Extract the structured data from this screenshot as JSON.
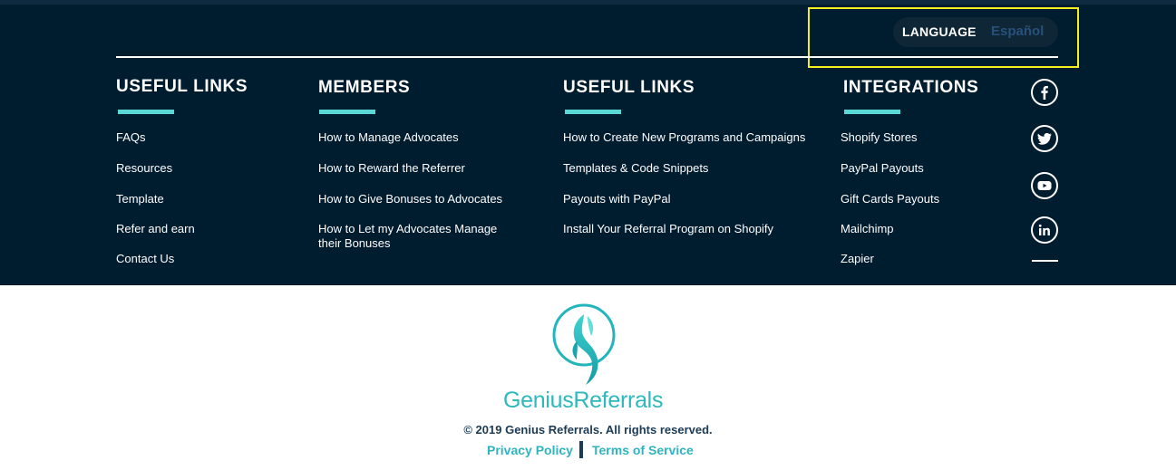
{
  "language": {
    "label": "LANGUAGE",
    "value": "Español"
  },
  "columns": [
    {
      "title": "USEFUL LINKS",
      "links": [
        "FAQs",
        "Resources",
        "Template",
        "Refer and earn",
        "Contact Us"
      ]
    },
    {
      "title": "MEMBERS",
      "links": [
        "How to Manage Advocates",
        "How to Reward the Referrer",
        "How to Give Bonuses to Advocates",
        "How to Let my Advocates Manage their Bonuses"
      ]
    },
    {
      "title": "USEFUL LINKS",
      "links": [
        "How to Create New Programs and Campaigns",
        "Templates & Code Snippets",
        "Payouts with PayPal",
        "Install Your Referral Program on Shopify"
      ]
    },
    {
      "title": "INTEGRATIONS",
      "links": [
        "Shopify Stores",
        "PayPal Payouts",
        "Gift Cards Payouts",
        "Mailchimp",
        "Zapier"
      ]
    }
  ],
  "social_icons": [
    "facebook-icon",
    "twitter-icon",
    "youtube-icon",
    "linkedin-icon"
  ],
  "brand": {
    "name_part1": "Genius",
    "name_part2": "Referrals"
  },
  "copyright": "© 2019 Genius Referrals. All rights reserved.",
  "legal": {
    "privacy": "Privacy Policy",
    "terms": "Terms of Service"
  },
  "colors": {
    "footer_bg": "#001c2f",
    "accent": "#5ad8d6",
    "brand": "#2db8bd",
    "highlight": "#f5ef1e"
  }
}
